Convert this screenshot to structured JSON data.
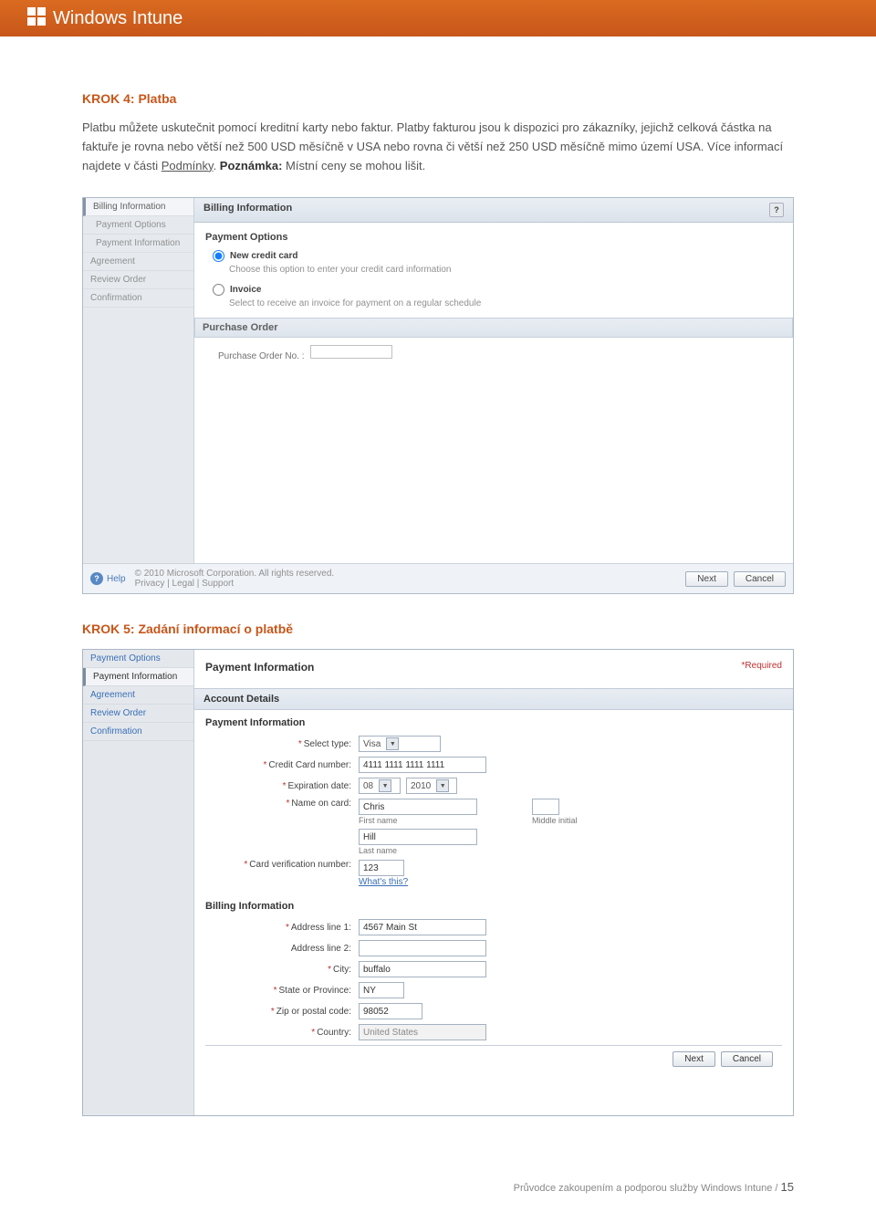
{
  "brand": "Windows Intune",
  "step4": {
    "title": "KROK 4: Platba",
    "body_a": "Platbu můžete uskutečnit pomocí kreditní karty nebo faktur. Platby fakturou jsou k dispozici pro zákazníky, jejichž celková částka na faktuře je rovna nebo větší než 500 USD měsíčně v USA nebo rovna či větší než 250 USD měsíčně mimo území USA. Více informací najdete v části ",
    "link": "Podmínky",
    "body_b": ". ",
    "note_label": "Poznámka:",
    "note_text": " Místní ceny se mohou lišit."
  },
  "ss1": {
    "sidebar": [
      "Billing Information",
      "Payment Options",
      "Payment Information",
      "Agreement",
      "Review Order",
      "Confirmation"
    ],
    "header": "Billing Information",
    "section": "Payment Options",
    "opt1": {
      "label": "New credit card",
      "desc": "Choose this option to enter your credit card information"
    },
    "opt2": {
      "label": "Invoice",
      "desc": "Select to receive an invoice for payment on a regular schedule"
    },
    "po_header": "Purchase Order",
    "po_label": "Purchase Order No. :",
    "help": "Help",
    "copy1": "© 2010 Microsoft Corporation. All rights reserved.",
    "copy2": "Privacy | Legal | Support",
    "next": "Next",
    "cancel": "Cancel"
  },
  "step5": {
    "title": "KROK 5: Zadání informací o platbě"
  },
  "ss2": {
    "sidebar": [
      "Payment Options",
      "Payment Information",
      "Agreement",
      "Review Order",
      "Confirmation"
    ],
    "header": "Payment Information",
    "required": "*Required",
    "acct": "Account Details",
    "pi": "Payment Information",
    "type_label": "Select type:",
    "type_value": "Visa",
    "cc_label": "Credit Card number:",
    "cc_value": "4111 1111 1111 1111",
    "exp_label": "Expiration date:",
    "exp_m": "08",
    "exp_y": "2010",
    "name_label": "Name on card:",
    "first": "Chris",
    "first_sub": "First name",
    "mid_sub": "Middle initial",
    "last": "Hill",
    "last_sub": "Last name",
    "cvn_label": "Card verification number:",
    "cvn_value": "123",
    "whats": "What's this?",
    "bi": "Billing Information",
    "addr1_label": "Address line 1:",
    "addr1_value": "4567 Main St",
    "addr2_label": "Address line 2:",
    "city_label": "City:",
    "city_value": "buffalo",
    "state_label": "State or Province:",
    "state_value": "NY",
    "zip_label": "Zip or postal code:",
    "zip_value": "98052",
    "country_label": "Country:",
    "country_value": "United States",
    "next": "Next",
    "cancel": "Cancel"
  },
  "footer": {
    "text": "Průvodce zakoupením a podporou služby Windows Intune / ",
    "page": "15"
  }
}
